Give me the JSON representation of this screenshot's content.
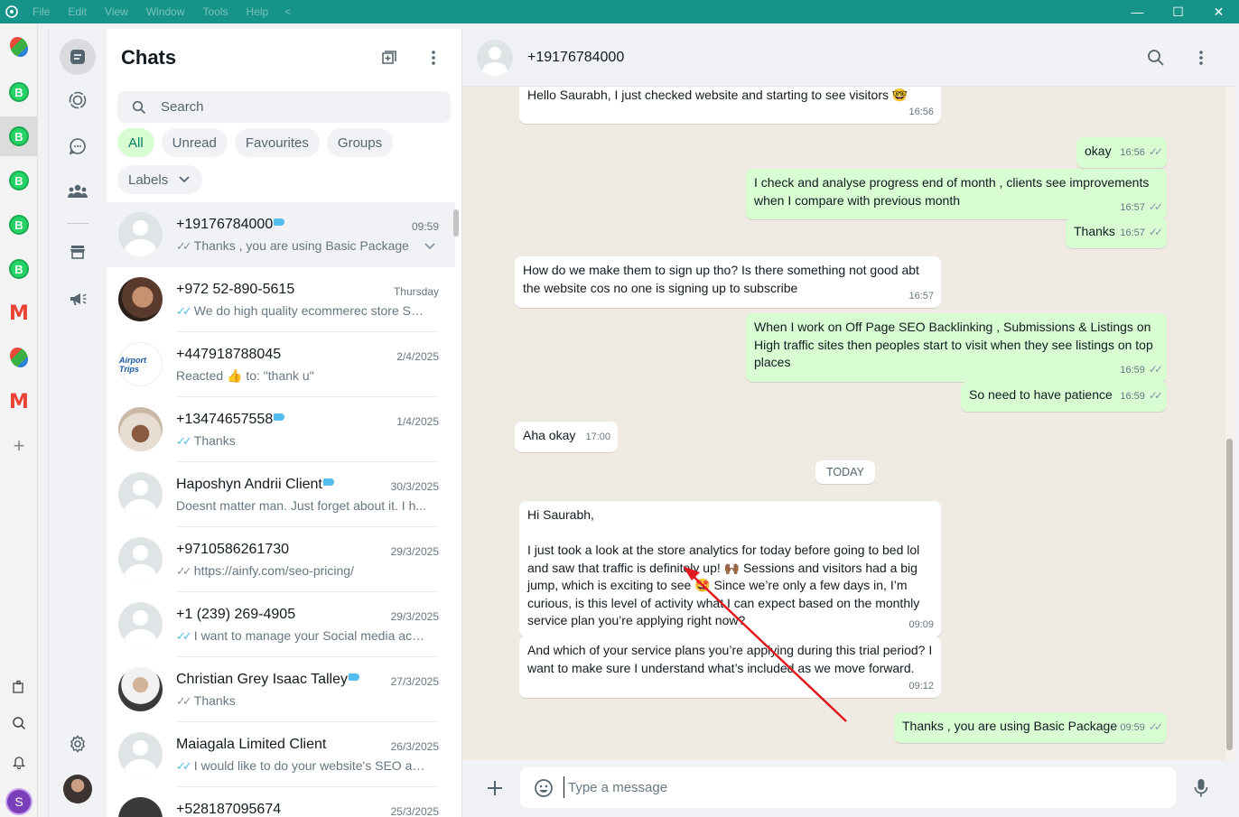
{
  "titlebar": {
    "menu": [
      "File",
      "Edit",
      "View",
      "Window",
      "Tools",
      "Help"
    ],
    "back": "<",
    "minimize": "—",
    "maximize": "☐",
    "close": "✕"
  },
  "rail": {
    "business_badge": "B",
    "gmail_glyph": "M",
    "profile_initial": "S"
  },
  "chatlist": {
    "title": "Chats",
    "search_placeholder": "Search",
    "filters": [
      "All",
      "Unread",
      "Favourites",
      "Groups"
    ],
    "labels_button": "Labels",
    "chats": [
      {
        "name": "+19176784000",
        "label": true,
        "time": "09:59",
        "preview": "Thanks , you are using Basic Package",
        "ticks": "grey",
        "avatar": "placeholder"
      },
      {
        "name": "+972 52-890-5615",
        "label": false,
        "time": "Thursday",
        "preview": "We do high quality ecommerec store SE...",
        "ticks": "blue",
        "avatar": "photo"
      },
      {
        "name": "+447918788045",
        "label": false,
        "time": "2/4/2025",
        "preview": "Reacted 👍 to: \"thank u\"",
        "ticks": "none",
        "avatar": "logo",
        "avatar_text": "Airport Trips"
      },
      {
        "name": "+13474657558",
        "label": true,
        "time": "1/4/2025",
        "preview": "Thanks",
        "ticks": "blue",
        "avatar": "photo"
      },
      {
        "name": "Haposhyn Andrii Client",
        "label": true,
        "time": "30/3/2025",
        "preview": "Doesnt matter man. Just forget about it. I h...",
        "ticks": "none",
        "avatar": "placeholder"
      },
      {
        "name": "+9710586261730",
        "label": false,
        "time": "29/3/2025",
        "preview": "https://ainfy.com/seo-pricing/",
        "ticks": "grey",
        "avatar": "placeholder"
      },
      {
        "name": "+1 (239) 269-4905",
        "label": false,
        "time": "29/3/2025",
        "preview": "I want to manage your Social media acco...",
        "ticks": "blue",
        "avatar": "placeholder"
      },
      {
        "name": "Christian Grey Isaac Talley",
        "label": true,
        "time": "27/3/2025",
        "preview": "Thanks",
        "ticks": "grey",
        "avatar": "photo"
      },
      {
        "name": "Maiagala Limited Client",
        "label": false,
        "time": "26/3/2025",
        "preview": "I would like to do your website's SEO an...",
        "ticks": "blue",
        "avatar": "placeholder"
      },
      {
        "name": "+528187095674",
        "label": false,
        "time": "25/3/2025",
        "preview": "",
        "ticks": "none",
        "avatar": "photo"
      }
    ]
  },
  "conversation": {
    "title": "+19176784000",
    "day_divider": "TODAY",
    "messages": [
      {
        "dir": "in",
        "text": "Hello Saurabh, I just checked website and starting to see visitors 🤓",
        "time": "16:56"
      },
      {
        "dir": "out",
        "text": "okay",
        "time": "16:56"
      },
      {
        "dir": "out",
        "text": "I check and analyse progress end of month , clients see improvements when I compare with previous month",
        "time": "16:57"
      },
      {
        "dir": "out",
        "text": "Thanks",
        "time": "16:57"
      },
      {
        "dir": "in",
        "text": "How do we make them to sign up tho? Is there something not good abt the website cos no one is signing up to subscribe",
        "time": "16:57"
      },
      {
        "dir": "out",
        "text": "When I work on Off Page SEO Backlinking , Submissions & Listings on High traffic sites then peoples start to visit when they see listings on top places",
        "time": "16:59"
      },
      {
        "dir": "out",
        "text": "So need to have patience",
        "time": "16:59"
      },
      {
        "dir": "in",
        "text": "Aha okay",
        "time": "17:00"
      },
      {
        "dir": "in",
        "text": "Hi Saurabh,\n\nI just took a look at the store analytics for today before going to bed lol and saw that traffic is definitely up! 🙌🏾 Sessions and visitors had a big jump, which is exciting to see 🤩 Since we’re only a few days in, I’m curious, is this level of activity what I can expect based on the monthly service plan you’re applying right now?",
        "time": "09:09"
      },
      {
        "dir": "in",
        "text": "And which of your service plans you’re applying during this trial period? I want to make sure I understand what’s included as we move forward.",
        "time": "09:12"
      },
      {
        "dir": "out",
        "text": "Thanks , you are using Basic Package",
        "time": "09:59"
      }
    ],
    "composer_placeholder": "Type a message"
  },
  "colors": {
    "titlebar": "#16948a",
    "outgoing_bubble": "#d9fdd3",
    "accent_green": "#008069",
    "read_ticks": "#53bdeb",
    "annotation_arrow": "#e0191f"
  }
}
